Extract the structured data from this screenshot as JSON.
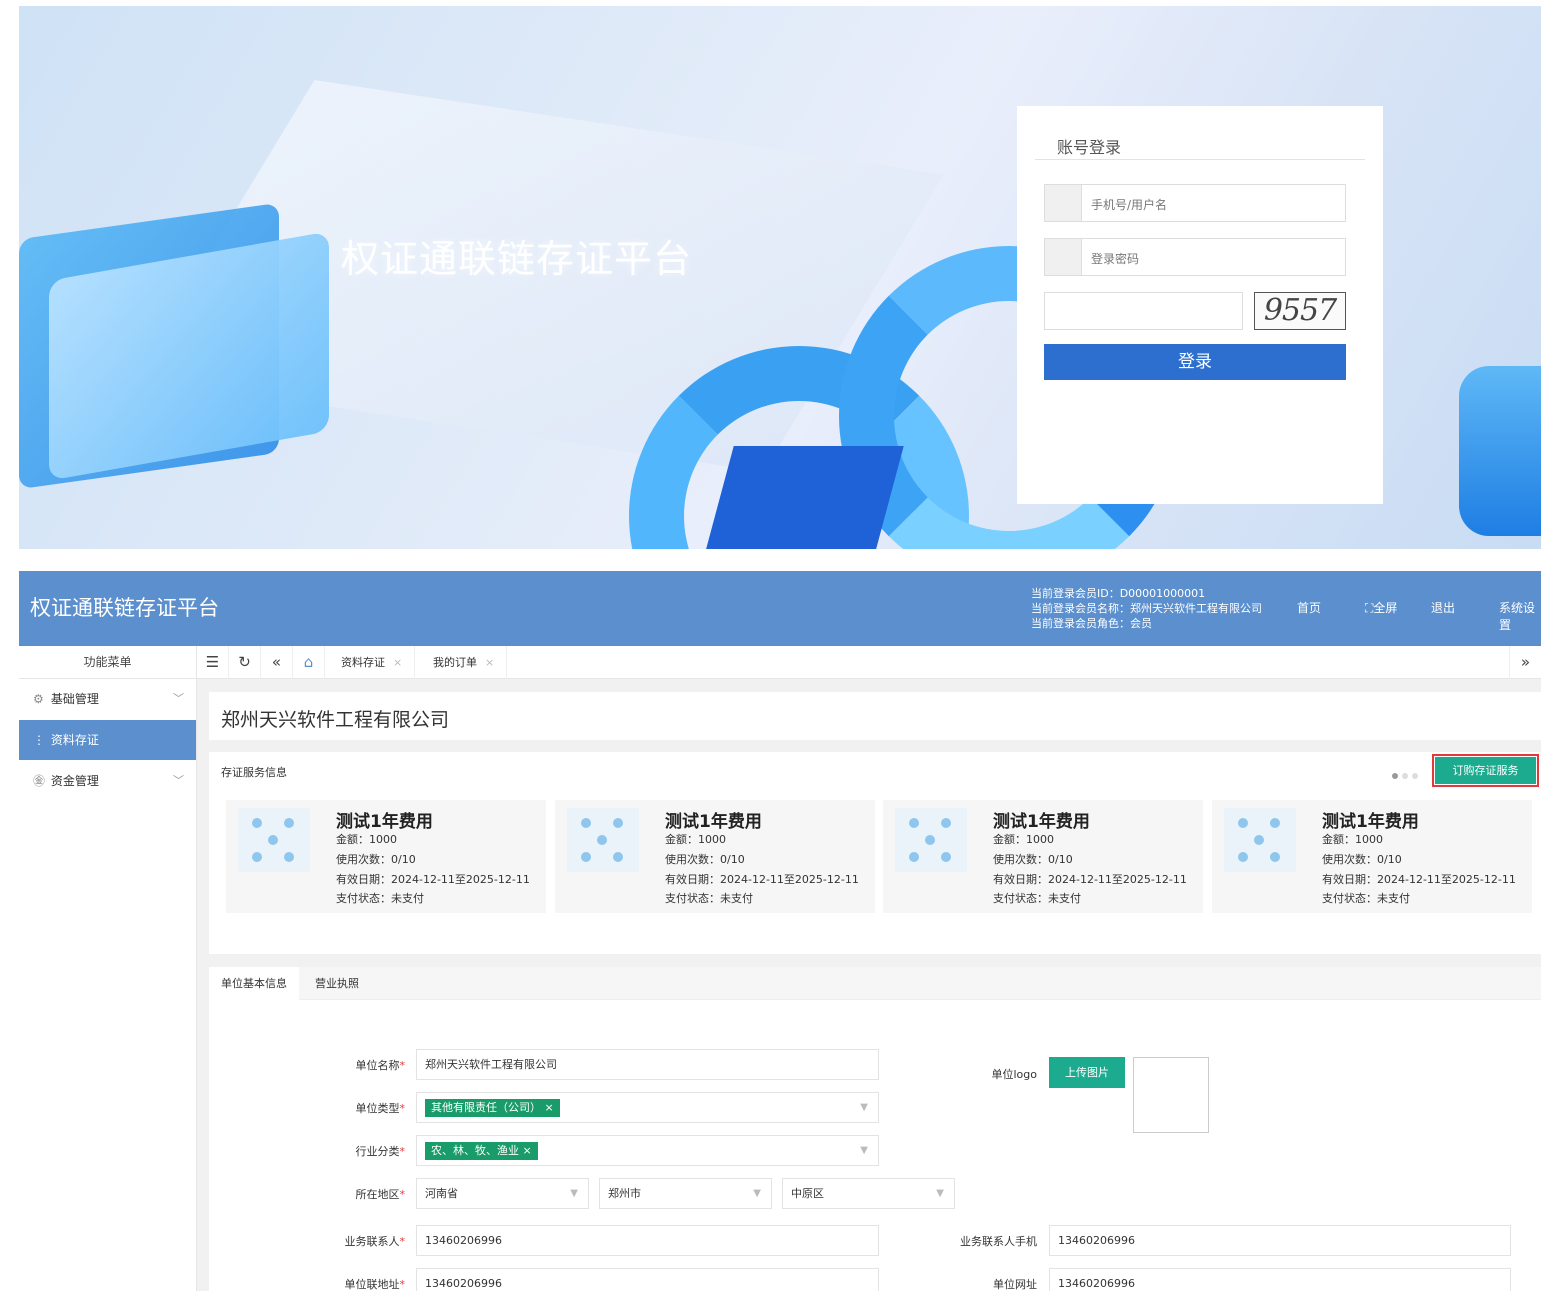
{
  "login": {
    "platform_title": "权证通联链存证平台",
    "box_title": "账号登录",
    "username_placeholder": "手机号/用户名",
    "password_placeholder": "登录密码",
    "captcha_text": "9557",
    "login_button": "登录"
  },
  "admin": {
    "app_title": "权证通联链存证平台",
    "user": {
      "id_line": "当前登录会员ID：D00001000001",
      "name_line": "当前登录会员名称：郑州天兴软件工程有限公司",
      "role_line": "当前登录会员角色：会员"
    },
    "top_nav": [
      "首页",
      "全屏",
      "退出",
      "系统设置"
    ],
    "side_head": "功能菜单",
    "tabs": [
      "资料存证",
      "我的订单"
    ],
    "sidebar": [
      {
        "label": "基础管理",
        "icon": "gear-icon"
      },
      {
        "label": "资料存证",
        "icon": "dots-icon"
      },
      {
        "label": "资金管理",
        "icon": "yen-icon"
      }
    ],
    "company_name": "郑州天兴软件工程有限公司",
    "service_panel_title": "存证服务信息",
    "order_button": "订购存证服务",
    "services": [
      {
        "title": "测试1年费用",
        "amount": "金额：1000",
        "uses": "使用次数：0/10",
        "valid": "有效日期：2024-12-11至2025-12-11",
        "pay": "支付状态：未支付"
      },
      {
        "title": "测试1年费用",
        "amount": "金额：1000",
        "uses": "使用次数：0/10",
        "valid": "有效日期：2024-12-11至2025-12-11",
        "pay": "支付状态：未支付"
      },
      {
        "title": "测试1年费用",
        "amount": "金额：1000",
        "uses": "使用次数：0/10",
        "valid": "有效日期：2024-12-11至2025-12-11",
        "pay": "支付状态：未支付"
      },
      {
        "title": "测试1年费用",
        "amount": "金额：1000",
        "uses": "使用次数：0/10",
        "valid": "有效日期：2024-12-11至2025-12-11",
        "pay": "支付状态：未支付"
      }
    ],
    "info_tabs": [
      "单位基本信息",
      "营业执照"
    ],
    "form": {
      "unit_name_label": "单位名称",
      "unit_name": "郑州天兴软件工程有限公司",
      "unit_type_label": "单位类型",
      "unit_type": "其他有限责任（公司）",
      "industry_label": "行业分类",
      "industry": "农、林、牧、渔业",
      "region_label": "所在地区",
      "province": "河南省",
      "city": "郑州市",
      "district": "中原区",
      "contact_label": "业务联系人",
      "contact": "13460206996",
      "contact_phone_label": "业务联系人手机",
      "contact_phone": "13460206996",
      "address_label": "单位联地址",
      "address": "13460206996",
      "website_label": "单位网址",
      "website": "13460206996",
      "logo_label": "单位logo",
      "upload_button": "上传图片"
    }
  },
  "colors": {
    "primary": "#5b8fcd",
    "login_button": "#2c6fcf",
    "accent_green": "#1cab8e",
    "chip_green": "#1a9b6a",
    "highlight_red": "#e23a3a"
  }
}
